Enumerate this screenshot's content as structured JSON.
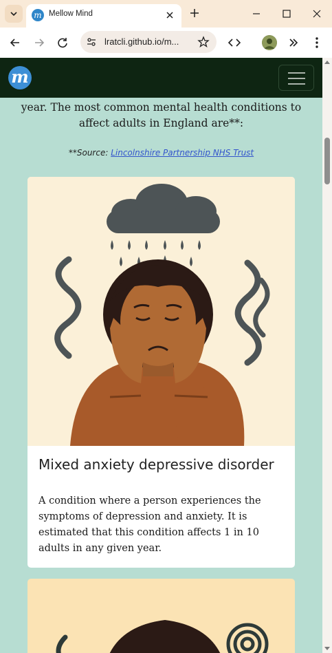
{
  "browser": {
    "tab_title": "Mellow Mind",
    "favicon_letter": "m",
    "url": "lratcli.github.io/m..."
  },
  "site": {
    "logo_letter": "m",
    "intro": "experience a mental health problem in any given year. The most common mental health conditions to affect adults in England are**:",
    "source_prefix": "**Source: ",
    "source_link": "Lincolnshire Partnership NHS Trust"
  },
  "cards": [
    {
      "title": "Mixed anxiety depressive disorder",
      "text": "A condition where a person experiences the symptoms of depression and anxiety. It is estimated that this condition affects 1 in 10 adults in any given year."
    }
  ],
  "colors": {
    "page_bg": "#b7ddd2",
    "navbar_bg": "#0e2512",
    "logo_blue": "#3d8fd6",
    "link": "#3355cc"
  },
  "icons": [
    "tab-search-icon",
    "close-icon",
    "plus-icon",
    "minimize-icon",
    "maximize-icon",
    "back-icon",
    "forward-icon",
    "reload-icon",
    "site-info-icon",
    "star-icon",
    "code-icon",
    "extensions-icon",
    "menu-icon",
    "hamburger-icon"
  ]
}
